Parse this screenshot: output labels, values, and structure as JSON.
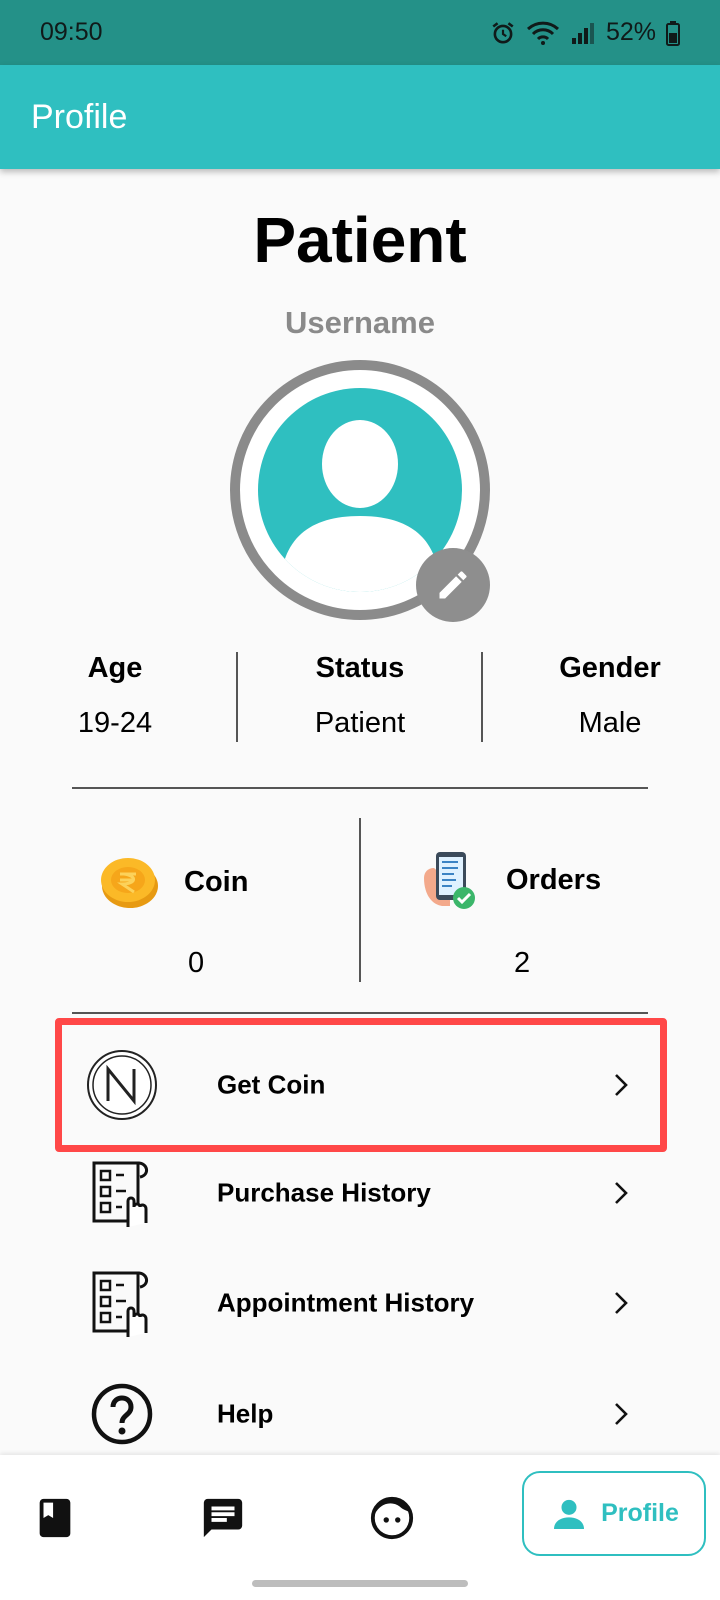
{
  "status_bar": {
    "time": "09:50",
    "battery": "52%",
    "icons": [
      "alarm-icon",
      "wifi-icon",
      "signal-icon",
      "battery-icon"
    ]
  },
  "app_bar": {
    "title": "Profile"
  },
  "profile": {
    "title": "Patient",
    "username": "Username",
    "avatar_icon": "person-icon",
    "edit_icon": "pencil-icon"
  },
  "info": {
    "age_label": "Age",
    "age_value": "19-24",
    "status_label": "Status",
    "status_value": "Patient",
    "gender_label": "Gender",
    "gender_value": "Male"
  },
  "stats": {
    "coin_label": "Coin",
    "coin_value": "0",
    "orders_label": "Orders",
    "orders_value": "2"
  },
  "menu": {
    "items": [
      {
        "label": "Get Coin",
        "icon": "coin-logo-icon"
      },
      {
        "label": "Purchase History",
        "icon": "checklist-icon"
      },
      {
        "label": "Appointment History",
        "icon": "checklist-icon"
      },
      {
        "label": "Help",
        "icon": "help-icon"
      }
    ]
  },
  "bottom_nav": {
    "items": [
      {
        "icon": "book-icon"
      },
      {
        "icon": "chat-icon"
      },
      {
        "icon": "face-icon"
      },
      {
        "icon": "person-icon",
        "label": "Profile"
      }
    ]
  },
  "colors": {
    "accent": "#2fbfc0",
    "status_bar": "#249188",
    "highlight": "#ff4848"
  }
}
